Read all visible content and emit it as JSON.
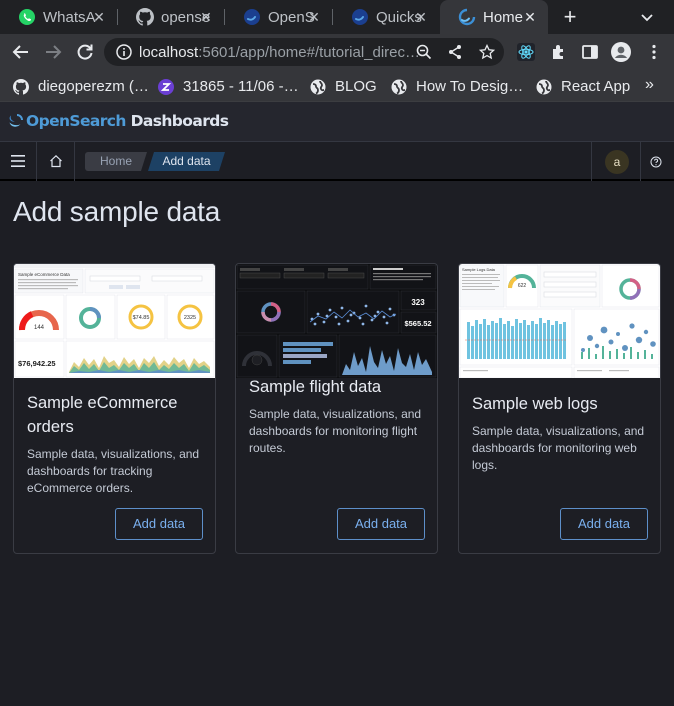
{
  "browser": {
    "tabs": [
      {
        "title": "WhatsA",
        "icon": "whatsapp-icon",
        "active": false
      },
      {
        "title": "opense",
        "icon": "github-icon",
        "active": false
      },
      {
        "title": "OpenS",
        "icon": "opensearch-icon",
        "active": false
      },
      {
        "title": "Quicks",
        "icon": "opensearch-icon",
        "active": false
      },
      {
        "title": "Home",
        "icon": "opensearch-icon",
        "active": true
      }
    ],
    "url_host": "localhost",
    "url_path": ":5601/app/home#/tutorial_direc…",
    "bookmarks": [
      {
        "label": "diegoperezm (…",
        "icon": "github-icon"
      },
      {
        "label": "31865 - 11/06 -…",
        "icon": "z-icon"
      },
      {
        "label": "BLOG",
        "icon": "globe-icon"
      },
      {
        "label": "How To Desig…",
        "icon": "globe-icon"
      },
      {
        "label": "React App",
        "icon": "globe-icon"
      }
    ],
    "bookmarks_more": "»"
  },
  "app": {
    "logo_brand": "OpenSearch",
    "logo_product": " Dashboards",
    "breadcrumbs": [
      "Home",
      "Add data"
    ],
    "avatar_initial": "a"
  },
  "page": {
    "title": "Add sample data",
    "cards": [
      {
        "title": "Sample eCommerce orders",
        "description": "Sample data, visualizations, and dashboards for tracking eCommerce orders.",
        "button": "Add data",
        "thumb_title": "Sample eCommerce Data",
        "thumb_value": "$76,942.25",
        "thumb_gauge": "144",
        "thumb_stat_1": "$74.85",
        "thumb_stat_2": "2325"
      },
      {
        "title": "Sample flight data",
        "description": "Sample data, visualizations, and dashboards for monitoring flight routes.",
        "button": "Add data",
        "thumb_stat_1": "323",
        "thumb_stat_2": "$565.52"
      },
      {
        "title": "Sample web logs",
        "description": "Sample data, visualizations, and dashboards for monitoring web logs.",
        "button": "Add data",
        "thumb_title": "Sample Logs Data",
        "thumb_gauge": "622"
      }
    ]
  },
  "colors": {
    "background": "#1d1e24",
    "accent": "#7ab0ef",
    "breadcrumb_active": "#1d4164",
    "tab_active": "#35363a"
  }
}
